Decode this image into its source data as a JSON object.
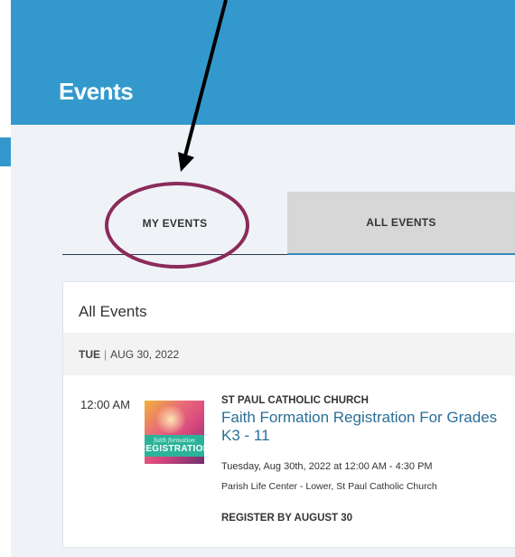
{
  "header": {
    "title": "Events",
    "band_color": "#3399cc"
  },
  "tabs": [
    {
      "label": "MY EVENTS",
      "selected": false
    },
    {
      "label": "ALL EVENTS",
      "selected": true
    }
  ],
  "card": {
    "title": "All Events",
    "date_group": {
      "day": "TUE",
      "separator": "|",
      "date": "AUG 30, 2022"
    },
    "event": {
      "time": "12:00 AM",
      "organization": "ST PAUL CATHOLIC CHURCH",
      "title": "Faith Formation Registration For Grades K3 - 11",
      "datetime": "Tuesday, Aug 30th, 2022 at 12:00 AM - 4:30 PM",
      "location": "Parish Life Center - Lower, St Paul Catholic Church",
      "register_label": "REGISTER BY AUGUST 30",
      "thumbnail": {
        "caption_small": "faith formation",
        "caption_big": "REGISTRATION"
      }
    }
  },
  "annotation": {
    "circle_color": "#8b2b5a",
    "arrow_color": "#000000"
  },
  "colors": {
    "link": "#2a6f97",
    "accent": "#3399cc"
  }
}
